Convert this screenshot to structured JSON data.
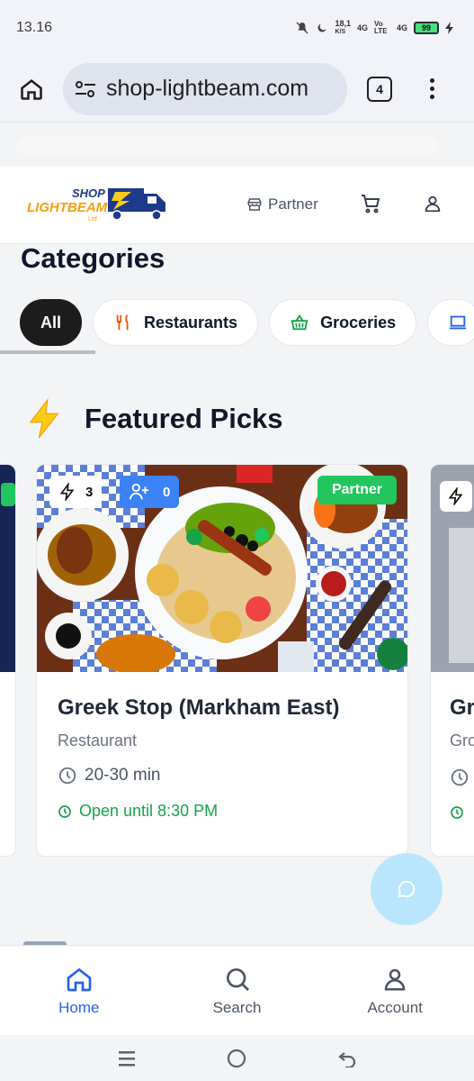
{
  "status_bar": {
    "time": "13.16",
    "net_speed": "18,1",
    "net_unit": "K/S",
    "net1": "4G",
    "net2": "Vo LTE",
    "net3": "4G",
    "battery": "99"
  },
  "browser": {
    "url": "shop-lightbeam.com",
    "tab_count": "4"
  },
  "header": {
    "logo_line1": "SHOP",
    "logo_line2": "LIGHTBEAM",
    "logo_line3": "Ltd",
    "partner_label": "Partner"
  },
  "categories": {
    "title": "Categories",
    "items": [
      {
        "label": "All",
        "active": true
      },
      {
        "label": "Restaurants",
        "icon": "fork-knife-icon"
      },
      {
        "label": "Groceries",
        "icon": "basket-icon"
      }
    ]
  },
  "featured": {
    "title": "Featured Picks",
    "card": {
      "flash_count": "3",
      "user_count": "0",
      "partner_badge": "Partner",
      "name": "Greek Stop (Markham East)",
      "type": "Restaurant",
      "time": "20-30 min",
      "open": "Open until 8:30 PM"
    },
    "next_card": {
      "name_partial": "Gr",
      "type_partial": "Gro"
    }
  },
  "bottom_nav": {
    "home": "Home",
    "search": "Search",
    "account": "Account"
  },
  "colors": {
    "accent": "#2563eb",
    "partner_green": "#22c55e",
    "open_green": "#16a34a",
    "user_badge": "#3b82f6"
  }
}
